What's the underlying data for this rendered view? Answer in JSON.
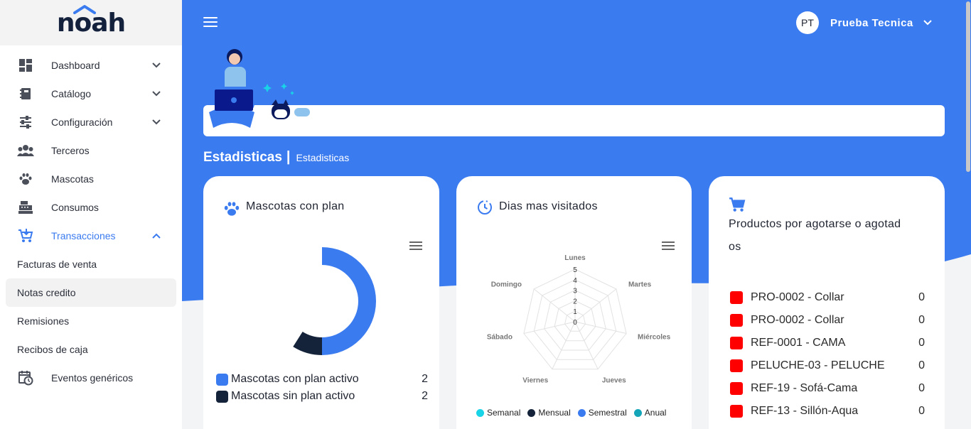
{
  "brand": {
    "logo_text": "noah"
  },
  "colors": {
    "primary": "#3b7bf0",
    "dark_navy": "#14213d",
    "alert_red": "#ff0000"
  },
  "sidebar": {
    "items": [
      {
        "label": "Dashboard",
        "icon": "dashboard-icon",
        "has_chevron": true
      },
      {
        "label": "Catálogo",
        "icon": "catalog-icon",
        "has_chevron": true
      },
      {
        "label": "Configuración",
        "icon": "settings-sliders-icon",
        "has_chevron": true
      },
      {
        "label": "Terceros",
        "icon": "people-icon",
        "has_chevron": false
      },
      {
        "label": "Mascotas",
        "icon": "paw-icon",
        "has_chevron": false
      },
      {
        "label": "Consumos",
        "icon": "cash-register-icon",
        "has_chevron": false
      },
      {
        "label": "Transacciones",
        "icon": "cart-icon",
        "has_chevron": true,
        "expanded": true
      }
    ],
    "subitems": [
      "Facturas de venta",
      "Notas credito",
      "Remisiones",
      "Recibos de caja"
    ],
    "selected_subitem": "Notas credito",
    "last_item": {
      "label": "Eventos genéricos",
      "icon": "calendar-clock-icon"
    }
  },
  "header": {
    "user_initials": "PT",
    "user_name": "Prueba Tecnica"
  },
  "breadcrumb": {
    "title": "Estadisticas",
    "separator": "|",
    "subtitle": "Estadisticas"
  },
  "cards": {
    "pets": {
      "title": "Mascotas con plan",
      "icon": "paw-icon",
      "legend": [
        {
          "label": "Mascotas con plan activo",
          "value": "2",
          "color": "#3b7bf0"
        },
        {
          "label": "Mascotas sin plan activo",
          "value": "2",
          "color": "#14233a"
        }
      ]
    },
    "visits": {
      "title": "Dias mas visitados",
      "icon": "clock-history-icon",
      "legend": [
        {
          "label": "Semanal",
          "color": "#19d3e6"
        },
        {
          "label": "Mensual",
          "color": "#14233a"
        },
        {
          "label": "Semestral",
          "color": "#3b7bf0"
        },
        {
          "label": "Anual",
          "color": "#14a6b8"
        }
      ]
    },
    "products": {
      "title": "Productos por agotarse o agotados",
      "title_lines": [
        "Productos por agotarse o agotad",
        "os"
      ],
      "icon": "cart-icon",
      "rows": [
        {
          "name": "PRO-0002 - Collar",
          "qty": "0"
        },
        {
          "name": "PRO-0002 - Collar",
          "qty": "0"
        },
        {
          "name": "REF-0001 - CAMA",
          "qty": "0"
        },
        {
          "name": "PELUCHE-03 - PELUCHE",
          "qty": "0"
        },
        {
          "name": "REF-19 - Sofá-Cama",
          "qty": "0"
        },
        {
          "name": "REF-13 - Sillón-Aqua",
          "qty": "0"
        }
      ]
    }
  },
  "chart_data": [
    {
      "type": "pie",
      "title": "Mascotas con plan",
      "categories": [
        "Mascotas con plan activo",
        "Mascotas sin plan activo"
      ],
      "values": [
        2,
        2
      ],
      "donut": true
    },
    {
      "type": "radar",
      "title": "Dias mas visitados",
      "categories": [
        "Lunes",
        "Martes",
        "Miércoles",
        "Jueves",
        "Viernes",
        "Sábado",
        "Domingo"
      ],
      "rlim": [
        0,
        5
      ],
      "ticks": [
        "0",
        "1",
        "2",
        "3",
        "4",
        "5"
      ],
      "series": [
        {
          "name": "Semanal",
          "values": [
            0,
            0,
            0,
            0,
            0,
            0,
            0
          ]
        },
        {
          "name": "Mensual",
          "values": [
            0,
            0,
            0,
            0,
            0,
            0,
            0
          ]
        },
        {
          "name": "Semestral",
          "values": [
            0,
            0,
            0,
            0,
            0,
            0,
            0
          ]
        },
        {
          "name": "Anual",
          "values": [
            0,
            0,
            0,
            0,
            0,
            0,
            0
          ]
        }
      ],
      "legend": "bottom"
    }
  ]
}
